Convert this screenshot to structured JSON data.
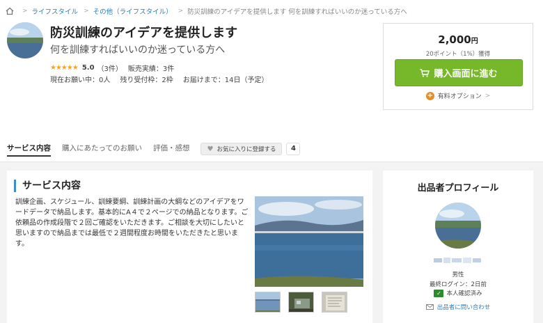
{
  "breadcrumb": {
    "items": [
      "ライフスタイル",
      "その他（ライフスタイル）"
    ],
    "current": "防災訓練のアイデアを提供します 何を訓練すればいいのか迷っている方へ"
  },
  "service": {
    "title": "防災訓練のアイデアを提供します",
    "subtitle": "何を訓練すればいいのか迷っている方へ",
    "stars": "★★★★★",
    "rating": "5.0",
    "reviews": "（3件）",
    "sales_label": "販売実績：",
    "sales_value": "3件",
    "requests": "現在お願い中：0人",
    "slots": "残り受付枠：2枠",
    "delivery": "お届けまで：14日（予定）"
  },
  "purchase": {
    "price": "2,000",
    "currency": "円",
    "points": "20ポイント（1%）獲得",
    "buy_label": "購入画面に進む",
    "option_label": "有料オプション"
  },
  "tabs": {
    "items": [
      "サービス内容",
      "購入にあたってのお願い",
      "評価・感想"
    ],
    "fav_label": "お気に入りに登録する",
    "fav_count": "4"
  },
  "content": {
    "section_title": "サービス内容",
    "description": "訓練企画、スケジュール、訓練要綱、訓練計画の大綱などのアイデアをワードデータで納品します。基本的にA４で２ページでの納品となります。ご依頼品の作成段階で２回ご確認をいただきます。ご相談を大切にしたいと思いますので納品までは最低で２週間程度お時間をいただきたと思います。"
  },
  "seller": {
    "title": "出品者プロフィール",
    "gender": "男性",
    "last_login": "最終ログイン：2日前",
    "verified": "本人確認済み",
    "contact": "出品者に問い合わせ"
  },
  "colors": {
    "accent_green": "#77b82a",
    "link_blue": "#2a7fb8",
    "star": "#f5a623"
  }
}
